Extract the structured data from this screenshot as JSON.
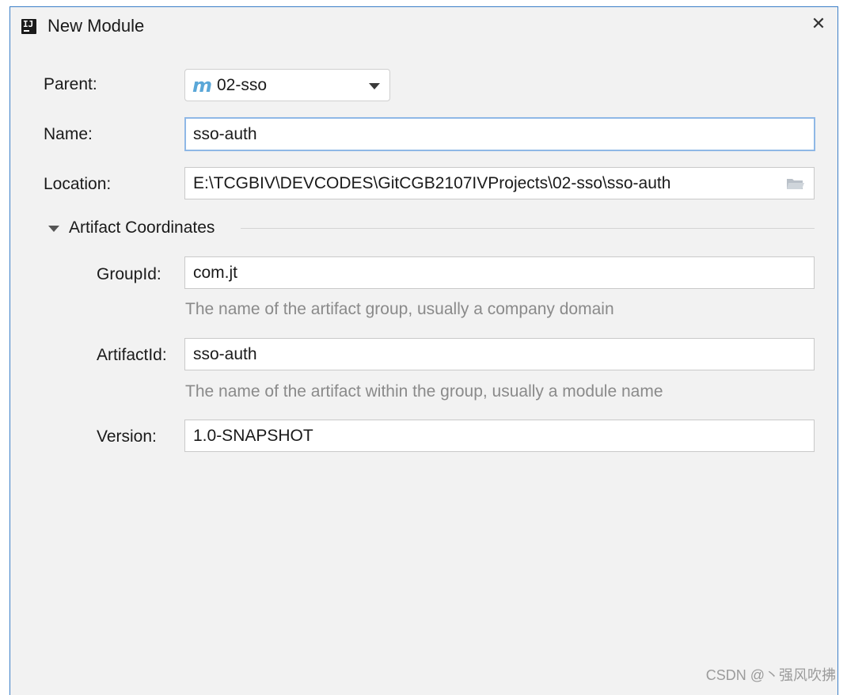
{
  "window": {
    "title": "New Module",
    "app_icon_glyph": "IJ",
    "close_glyph": "✕"
  },
  "form": {
    "parent": {
      "label": "Parent:",
      "value": "02-sso",
      "icon": "m"
    },
    "name": {
      "label": "Name:",
      "value": "sso-auth"
    },
    "location": {
      "label": "Location:",
      "value": "E:\\TCGBIV\\DEVCODES\\GitCGB2107IVProjects\\02-sso\\sso-auth"
    }
  },
  "artifact": {
    "section_title": "Artifact Coordinates",
    "group_id": {
      "label": "GroupId:",
      "value": "com.jt",
      "hint": "The name of the artifact group, usually a company domain"
    },
    "artifact_id": {
      "label": "ArtifactId:",
      "value": "sso-auth",
      "hint": "The name of the artifact within the group, usually a module name"
    },
    "version": {
      "label": "Version:",
      "value": "1.0-SNAPSHOT"
    }
  },
  "watermark": "CSDN @丶强风吹拂",
  "colors": {
    "window_border": "#3c7fc7",
    "focus_ring": "#8fb8e6",
    "maven_icon": "#5aa7d8",
    "hint_text": "#8a8a8a"
  }
}
